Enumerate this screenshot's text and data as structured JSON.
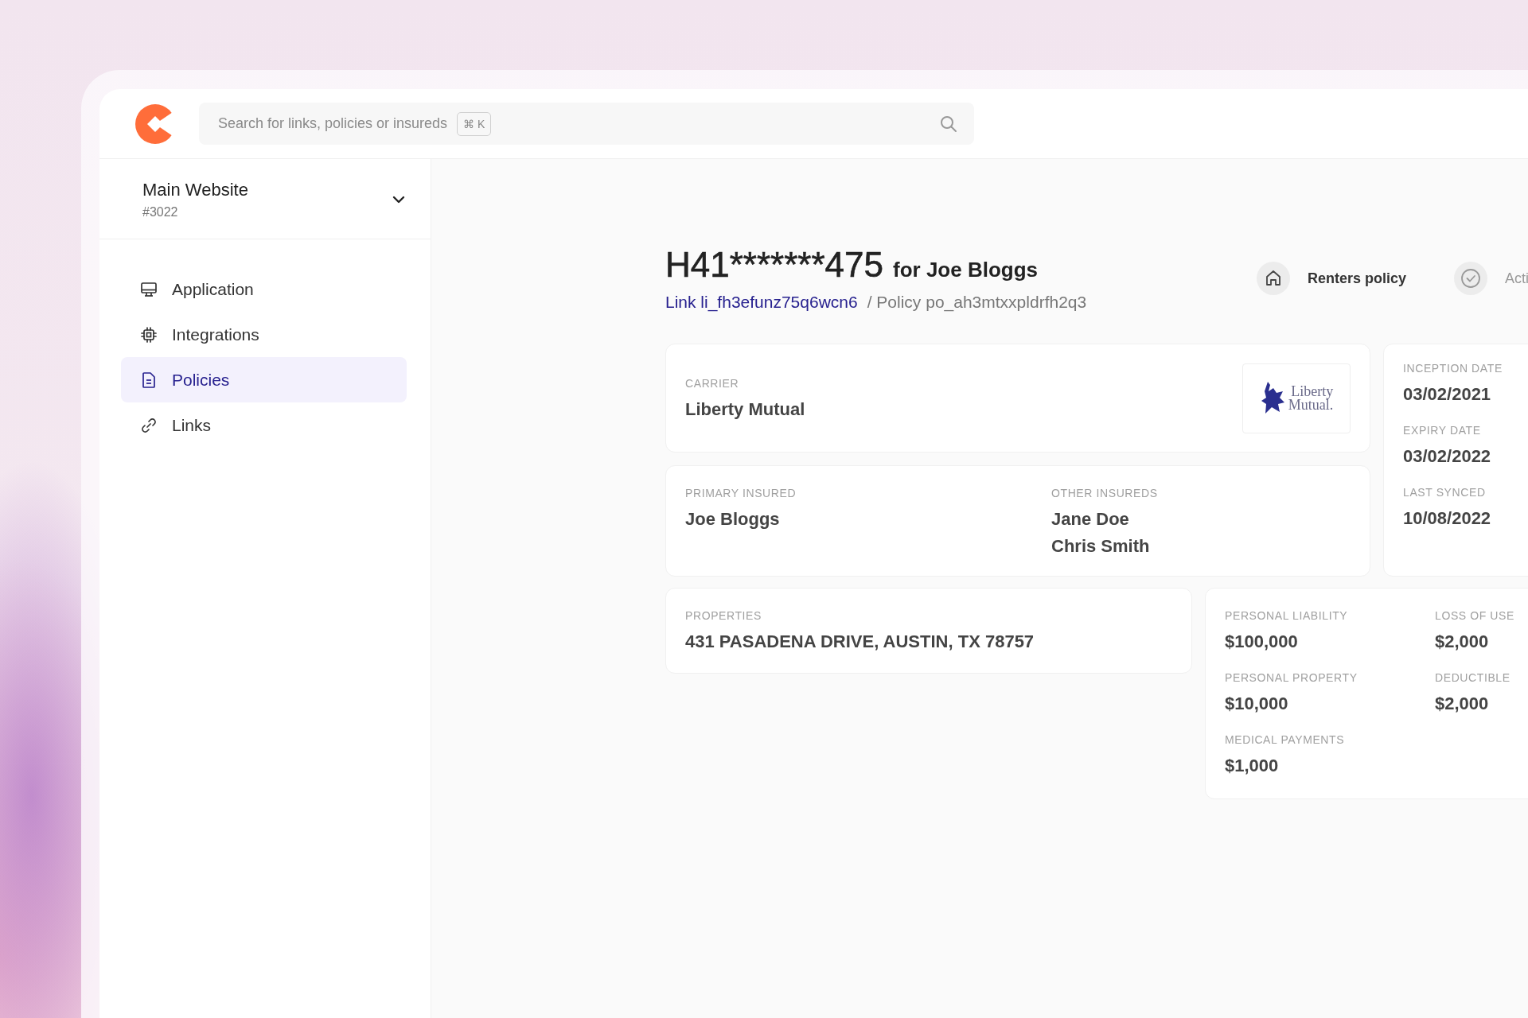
{
  "search": {
    "placeholder": "Search for links, policies or insureds",
    "shortcut": "⌘ K"
  },
  "workspace": {
    "name": "Main Website",
    "id": "#3022"
  },
  "nav": [
    {
      "label": "Application",
      "selected": false
    },
    {
      "label": "Integrations",
      "selected": false
    },
    {
      "label": "Policies",
      "selected": true
    },
    {
      "label": "Links",
      "selected": false
    }
  ],
  "policy": {
    "number": "H41*******475",
    "insured": "for Joe Bloggs",
    "link": "Link li_fh3efunz75q6wcn6",
    "reference": "/ Policy po_ah3mtxxpldrfh2q3"
  },
  "badges": [
    {
      "kind": "type",
      "label": "Renters policy"
    },
    {
      "kind": "status",
      "label": "Acti"
    }
  ],
  "carrier": {
    "label": "CARRIER",
    "value": "Liberty Mutual",
    "logo_lines": [
      "Liberty",
      "Mutual."
    ]
  },
  "insureds": {
    "primary_label": "PRIMARY INSURED",
    "primary": "Joe Bloggs",
    "other_label": "OTHER INSUREDS",
    "others": [
      "Jane Doe",
      "Chris Smith"
    ]
  },
  "dates": [
    {
      "label": "INCEPTION DATE",
      "value": "03/02/2021"
    },
    {
      "label": "EXPIRY DATE",
      "value": "03/02/2022"
    },
    {
      "label": "LAST SYNCED",
      "value": "10/08/2022"
    }
  ],
  "properties": {
    "label": "PROPERTIES",
    "value": "431 PASADENA DRIVE, AUSTIN, TX 78757"
  },
  "coverages": [
    {
      "label": "PERSONAL LIABILITY",
      "value": "$100,000"
    },
    {
      "label": "LOSS OF USE",
      "value": "$2,000"
    },
    {
      "label": "PERSONAL PROPERTY",
      "value": "$10,000"
    },
    {
      "label": "DEDUCTIBLE",
      "value": "$2,000"
    },
    {
      "label": "MEDICAL PAYMENTS",
      "value": "$1,000"
    }
  ]
}
